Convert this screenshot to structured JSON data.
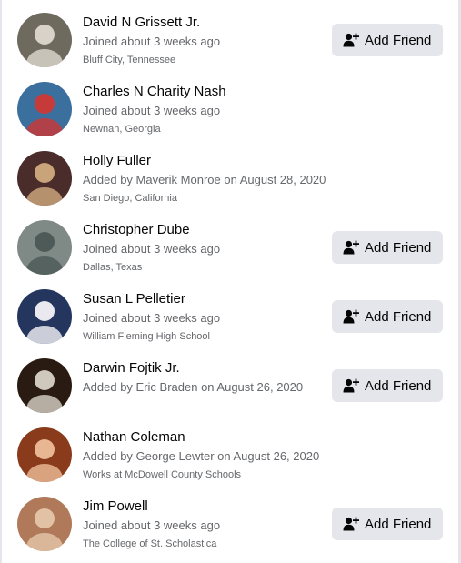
{
  "members": [
    {
      "name": "David N Grissett Jr.",
      "joined": "Joined about 3 weeks ago",
      "detail": "Bluff City, Tennessee",
      "has_add_friend": true,
      "avatar_bg": "#6e6a5e",
      "avatar_fg": "#d8d2c8"
    },
    {
      "name": "Charles N Charity Nash",
      "joined": "Joined about 3 weeks ago",
      "detail": "Newnan, Georgia",
      "has_add_friend": false,
      "avatar_bg": "#3b6f9e",
      "avatar_fg": "#c73a3a"
    },
    {
      "name": "Holly Fuller",
      "joined": "Added by Maverik Monroe on August 28, 2020",
      "detail": "San Diego, California",
      "has_add_friend": false,
      "avatar_bg": "#4a2c2a",
      "avatar_fg": "#c9a37a"
    },
    {
      "name": "Christopher Dube",
      "joined": "Joined about 3 weeks ago",
      "detail": "Dallas, Texas",
      "has_add_friend": true,
      "avatar_bg": "#7f8a86",
      "avatar_fg": "#4e5a58"
    },
    {
      "name": "Susan L Pelletier",
      "joined": "Joined about 3 weeks ago",
      "detail": "William Fleming High School",
      "has_add_friend": true,
      "avatar_bg": "#24365e",
      "avatar_fg": "#e9e9ef"
    },
    {
      "name": "Darwin Fojtik Jr.",
      "joined": "Added by Eric Braden on August 26, 2020",
      "detail": "",
      "has_add_friend": true,
      "avatar_bg": "#2a1b12",
      "avatar_fg": "#cfc8bd"
    },
    {
      "name": "Nathan Coleman",
      "joined": "Added by George Lewter on August 26, 2020",
      "detail": "Works at McDowell County Schools",
      "has_add_friend": false,
      "avatar_bg": "#8a3b1c",
      "avatar_fg": "#e8b692"
    },
    {
      "name": "Jim Powell",
      "joined": "Joined about 3 weeks ago",
      "detail": "The College of St. Scholastica",
      "has_add_friend": true,
      "avatar_bg": "#b07a5a",
      "avatar_fg": "#e2c2a4"
    }
  ],
  "add_friend_label": "Add Friend",
  "icons": {
    "add_friend": "person-plus-icon"
  },
  "colors": {
    "button_bg": "#e4e6eb",
    "name": "#050505",
    "secondary": "#65676b"
  }
}
